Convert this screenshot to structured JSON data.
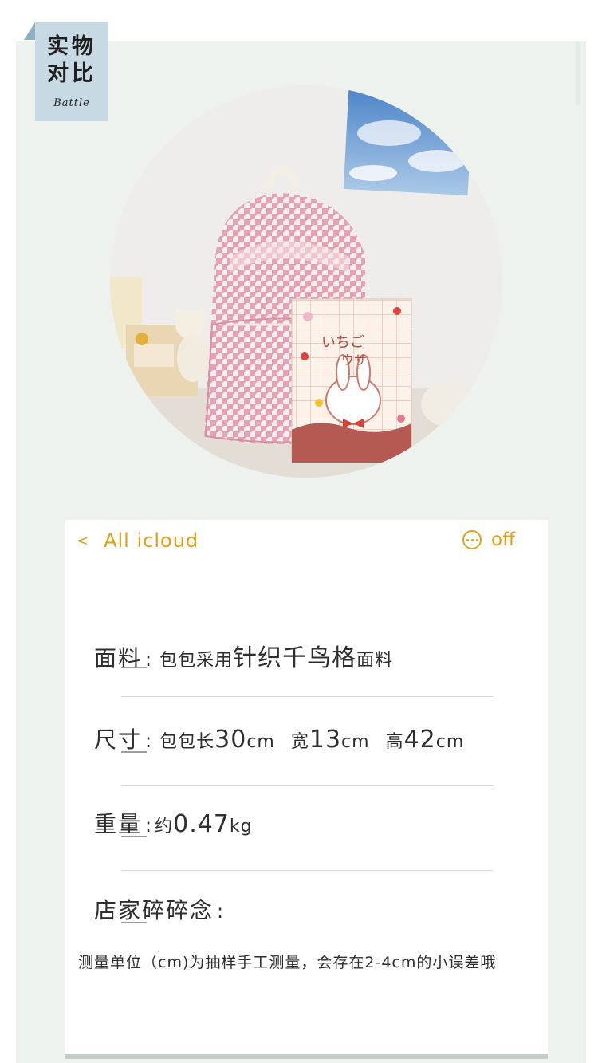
{
  "tag": {
    "line1": "实物",
    "line2": "对比",
    "line3": "Battle"
  },
  "notes_nav": {
    "back_label": "All icloud",
    "off_label": "off"
  },
  "spec": {
    "material": {
      "label": "面料",
      "colon": ":",
      "value_pre": "包包采用",
      "value_highlight": "针织千鸟格",
      "value_post": "面料"
    },
    "size": {
      "label": "尺寸",
      "colon": ":",
      "p1": "包包长",
      "n1": "30",
      "u1": "cm",
      "p2": "宽",
      "n2": "13",
      "u2": "cm",
      "p3": "高",
      "n3": "42",
      "u3": "cm"
    },
    "weight": {
      "label": "重量",
      "colon": ":",
      "p1": "约",
      "n1": "0.47",
      "u1": "kg"
    },
    "shop_note": {
      "label": "店家碎碎念",
      "colon": ":"
    },
    "disclaimer": "测量单位（cm)为抽样手工测量，会存在2-4cm的小误差哦"
  },
  "colors": {
    "accent": "#e0a21c",
    "tag_bg": "#c7d9e3",
    "panel_bg": "#eef2ef",
    "houndstooth_pink": "#e6a2b2"
  }
}
